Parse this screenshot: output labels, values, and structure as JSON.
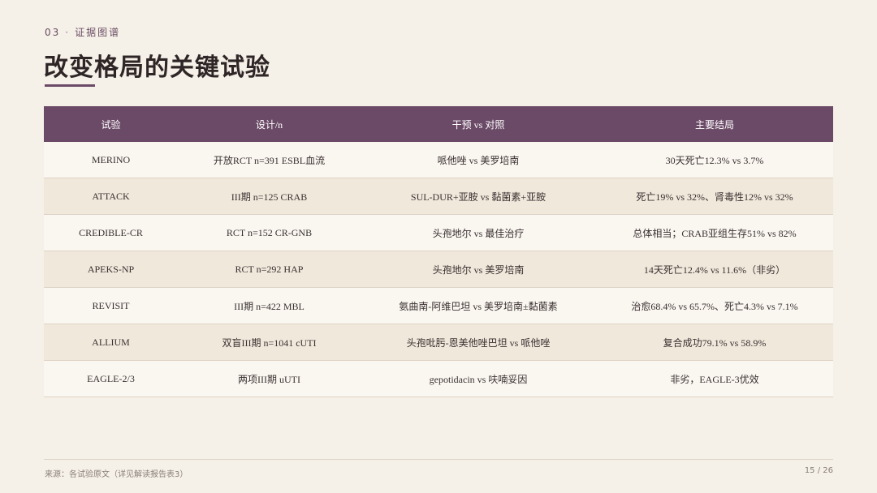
{
  "header": {
    "section_number": "03",
    "separator": "·",
    "section_name": "证据图谱",
    "title": "改变格局的关键试验"
  },
  "table": {
    "columns": [
      "试验",
      "设计/n",
      "干预 vs 对照",
      "主要结局"
    ],
    "rows": [
      [
        "MERINO",
        "开放RCT n=391 ESBL血流",
        "哌他唑 vs 美罗培南",
        "30天死亡12.3% vs 3.7%"
      ],
      [
        "ATTACK",
        "III期 n=125 CRAB",
        "SUL-DUR+亚胺 vs 黏菌素+亚胺",
        "死亡19% vs 32%、肾毒性12% vs 32%"
      ],
      [
        "CREDIBLE-CR",
        "RCT n=152 CR-GNB",
        "头孢地尔 vs 最佳治疗",
        "总体相当；CRAB亚组生存51% vs 82%"
      ],
      [
        "APEKS-NP",
        "RCT n=292 HAP",
        "头孢地尔 vs 美罗培南",
        "14天死亡12.4% vs 11.6%（非劣）"
      ],
      [
        "REVISIT",
        "III期 n=422 MBL",
        "氨曲南-阿维巴坦 vs 美罗培南±黏菌素",
        "治愈68.4% vs 65.7%、死亡4.3% vs 7.1%"
      ],
      [
        "ALLIUM",
        "双盲III期 n=1041 cUTI",
        "头孢吡肟-恩美他唑巴坦 vs 哌他唑",
        "复合成功79.1% vs 58.9%"
      ],
      [
        "EAGLE-2/3",
        "两项III期 uUTI",
        "gepotidacin vs 呋喃妥因",
        "非劣，EAGLE-3优效"
      ]
    ]
  },
  "footer": {
    "source": "来源：各试验原文（详见解读报告表3）",
    "page": "15 / 26"
  },
  "colors": {
    "background": "#f5f0e8",
    "accent": "#6b4a67",
    "row_light": "#faf7f1",
    "row_dark": "#f1e8dc"
  }
}
